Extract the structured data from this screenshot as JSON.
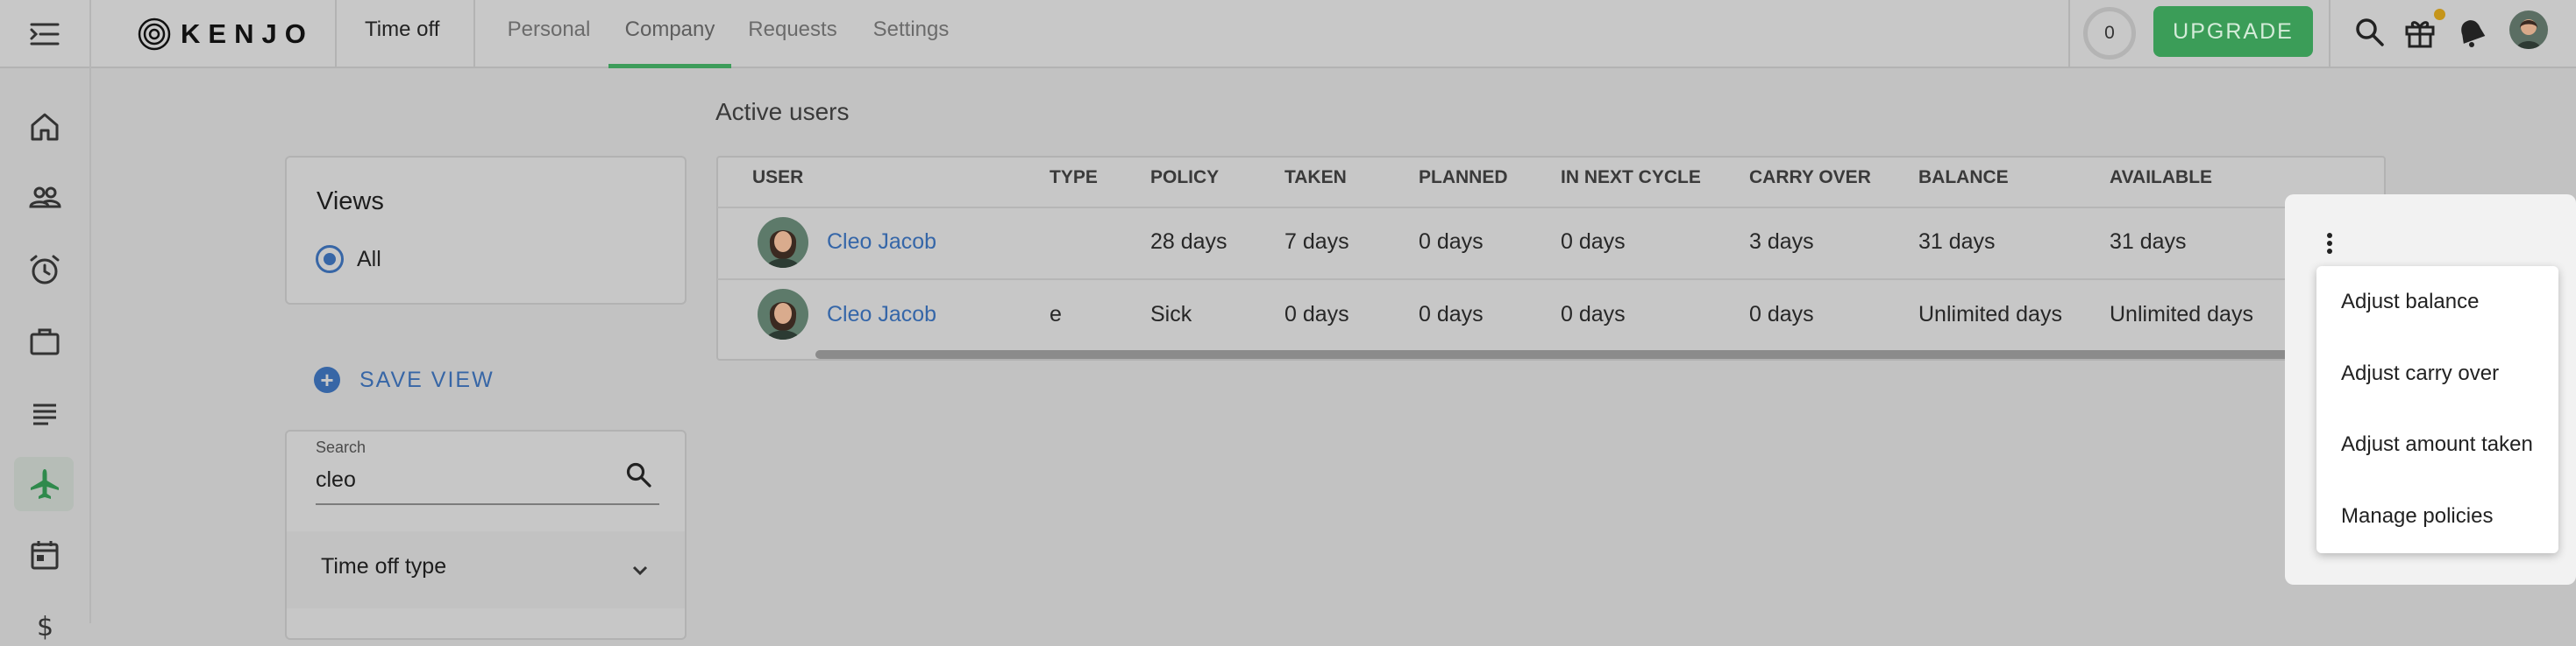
{
  "app": {
    "logo_text": "KENJO",
    "module_title": "Time off"
  },
  "nav": {
    "tabs": [
      {
        "label": "Personal"
      },
      {
        "label": "Company"
      },
      {
        "label": "Requests"
      },
      {
        "label": "Settings"
      }
    ],
    "active_tab": "Company"
  },
  "header": {
    "credits": "0",
    "upgrade_label": "UPGRADE"
  },
  "views": {
    "title": "Views",
    "option_label": "All"
  },
  "save_view": {
    "label": "SAVE VIEW"
  },
  "search": {
    "label": "Search",
    "value": "cleo"
  },
  "filter": {
    "time_off_type_label": "Time off type"
  },
  "table": {
    "section_title": "Active users",
    "columns": [
      "USER",
      "TYPE",
      "POLICY",
      "TAKEN",
      "PLANNED",
      "IN NEXT CYCLE",
      "CARRY OVER",
      "BALANCE",
      "AVAILABLE"
    ],
    "rows": [
      {
        "user": "Cleo Jacob",
        "type": "",
        "policy": "28 days",
        "taken": "7 days",
        "planned": "0 days",
        "in_next_cycle": "0 days",
        "carry_over": "3 days",
        "balance": "31 days",
        "available": "31 days"
      },
      {
        "user": "Cleo Jacob",
        "type": "e",
        "policy": "Sick",
        "taken": "0 days",
        "planned": "0 days",
        "in_next_cycle": "0 days",
        "carry_over": "0 days",
        "balance": "Unlimited days",
        "available": "Unlimited days"
      }
    ]
  },
  "row_menu": {
    "items": [
      "Adjust balance",
      "Adjust carry over",
      "Adjust amount taken",
      "Manage policies"
    ]
  },
  "colors": {
    "accent_green": "#3b9d58",
    "link_blue": "#3566a8",
    "notification_dot": "#c5951a"
  },
  "icons": {
    "rail": [
      "home-icon",
      "people-icon",
      "alarm-clock-icon",
      "briefcase-icon",
      "list-icon",
      "airplane-icon",
      "calendar-icon",
      "dollar-icon"
    ],
    "header": [
      "search-icon",
      "gift-icon",
      "bell-icon"
    ]
  }
}
